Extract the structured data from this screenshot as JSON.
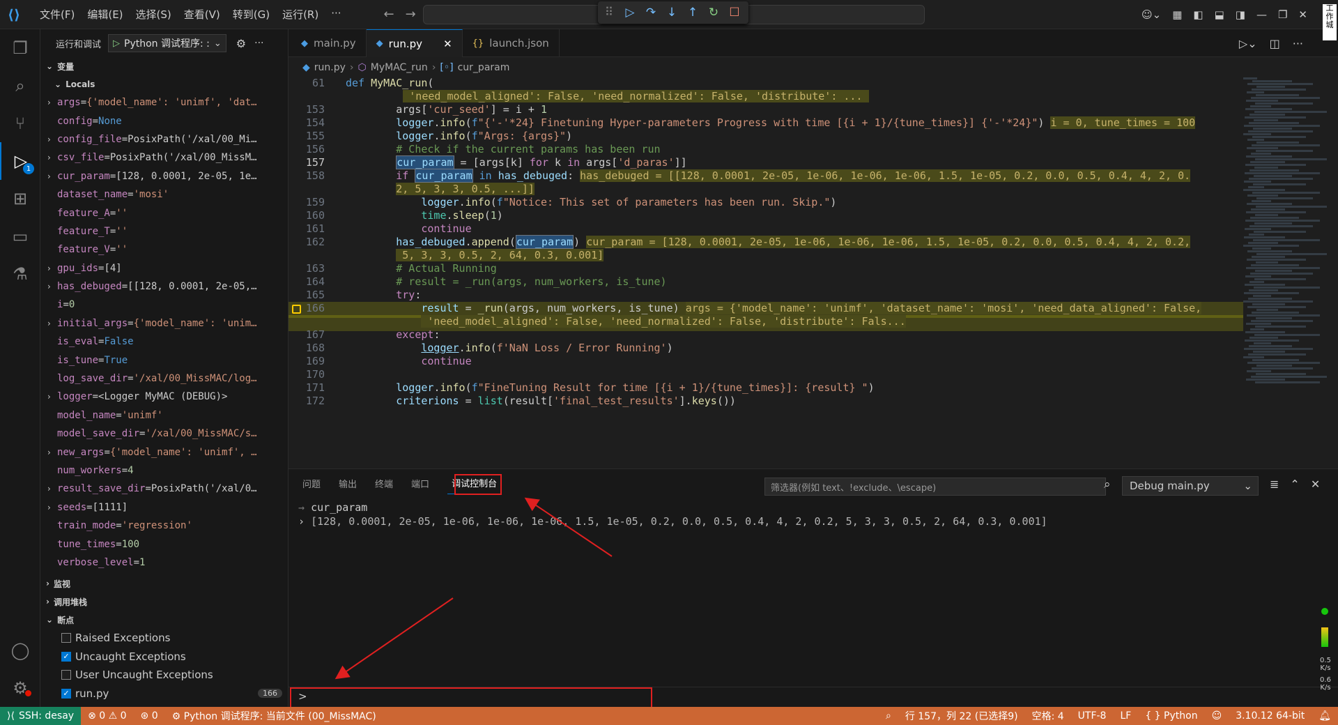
{
  "titlebar": {
    "menu": [
      "文件(F)",
      "编辑(E)",
      "选择(S)",
      "查看(V)",
      "转到(G)",
      "运行(R)",
      "···"
    ]
  },
  "sidebar": {
    "title": "运行和调试",
    "config_name": "Python 调试程序: :",
    "variables_label": "变量",
    "locals_label": "Locals",
    "variables": [
      {
        "expand": true,
        "name": "args",
        "value": "{'model_name': 'unimf', 'dat…",
        "kind": "str"
      },
      {
        "expand": false,
        "name": "config",
        "value": "None",
        "kind": "kw"
      },
      {
        "expand": true,
        "name": "config_file",
        "value": "PosixPath('/xal/00_Mi…",
        "kind": "plain"
      },
      {
        "expand": true,
        "name": "csv_file",
        "value": "PosixPath('/xal/00_MissM…",
        "kind": "plain"
      },
      {
        "expand": true,
        "name": "cur_param",
        "value": "[128, 0.0001, 2e-05, 1e…",
        "kind": "plain"
      },
      {
        "expand": false,
        "name": "dataset_name",
        "value": "'mosi'",
        "kind": "str"
      },
      {
        "expand": false,
        "name": "feature_A",
        "value": "''",
        "kind": "str"
      },
      {
        "expand": false,
        "name": "feature_T",
        "value": "''",
        "kind": "str"
      },
      {
        "expand": false,
        "name": "feature_V",
        "value": "''",
        "kind": "str"
      },
      {
        "expand": true,
        "name": "gpu_ids",
        "value": "[4]",
        "kind": "plain"
      },
      {
        "expand": true,
        "name": "has_debuged",
        "value": "[[128, 0.0001, 2e-05,…",
        "kind": "plain"
      },
      {
        "expand": false,
        "name": "i",
        "value": "0",
        "kind": "num"
      },
      {
        "expand": true,
        "name": "initial_args",
        "value": "{'model_name': 'unim…",
        "kind": "str"
      },
      {
        "expand": false,
        "name": "is_eval",
        "value": "False",
        "kind": "kw"
      },
      {
        "expand": false,
        "name": "is_tune",
        "value": "True",
        "kind": "kw"
      },
      {
        "expand": false,
        "name": "log_save_dir",
        "value": "'/xal/00_MissMAC/log…",
        "kind": "str"
      },
      {
        "expand": true,
        "name": "logger",
        "value": "<Logger MyMAC (DEBUG)>",
        "kind": "plain"
      },
      {
        "expand": false,
        "name": "model_name",
        "value": "'unimf'",
        "kind": "str"
      },
      {
        "expand": false,
        "name": "model_save_dir",
        "value": "'/xal/00_MissMAC/s…",
        "kind": "str"
      },
      {
        "expand": true,
        "name": "new_args",
        "value": "{'model_name': 'unimf', …",
        "kind": "str"
      },
      {
        "expand": false,
        "name": "num_workers",
        "value": "4",
        "kind": "num"
      },
      {
        "expand": true,
        "name": "result_save_dir",
        "value": "PosixPath('/xal/0…",
        "kind": "plain"
      },
      {
        "expand": true,
        "name": "seeds",
        "value": "[1111]",
        "kind": "plain"
      },
      {
        "expand": false,
        "name": "train_mode",
        "value": "'regression'",
        "kind": "str"
      },
      {
        "expand": false,
        "name": "tune_times",
        "value": "100",
        "kind": "num"
      },
      {
        "expand": false,
        "name": "verbose_level",
        "value": "1",
        "kind": "num"
      }
    ],
    "watch_label": "监视",
    "callstack_label": "调用堆栈",
    "breakpoints_label": "断点",
    "breakpoints": [
      {
        "label": "Raised Exceptions",
        "checked": false
      },
      {
        "label": "Uncaught Exceptions",
        "checked": true
      },
      {
        "label": "User Uncaught Exceptions",
        "checked": false
      },
      {
        "label": "run.py",
        "checked": true,
        "line": "166"
      }
    ]
  },
  "tabs": [
    {
      "label": "main.py",
      "active": false
    },
    {
      "label": "run.py",
      "active": true
    },
    {
      "label": "launch.json",
      "active": false
    }
  ],
  "breadcrumb": [
    "run.py",
    "MyMAC_run",
    "cur_param"
  ],
  "activity_badge": "1",
  "panel": {
    "tabs": [
      "问题",
      "输出",
      "终端",
      "端口",
      "调试控制台"
    ],
    "filter_placeholder": "筛选器(例如 text、!exclude、\\escape)",
    "debug_select": "Debug main.py",
    "output_expr": "cur_param",
    "output_value": "[128, 0.0001, 2e-05, 1e-06, 1e-06, 1e-06, 1.5, 1e-05, 0.2, 0.0, 0.5, 0.4, 4, 2, 0.2, 5, 3, 3, 0.5, 2, 64, 0.3, 0.001]",
    "prompt": ">"
  },
  "statusbar": {
    "remote": "SSH: desay",
    "problems": "⊗ 0 ⚠ 0",
    "ports": "0",
    "debug": "Python 调试程序: 当前文件 (00_MissMAC)",
    "position": "行 157，列 22 (已选择9)",
    "spaces": "空格: 4",
    "encoding": "UTF-8",
    "eol": "LF",
    "language": "Python",
    "interpreter": "3.10.12 64-bit"
  },
  "right_edge": {
    "speed_up": "0.5 K/s",
    "speed_down": "0.6 K/s",
    "label": "工作城"
  },
  "colors": {
    "statusbar": "#cc6633",
    "accent": "#0078d4",
    "highlight": "#ffff00",
    "annotation": "#e02020"
  }
}
